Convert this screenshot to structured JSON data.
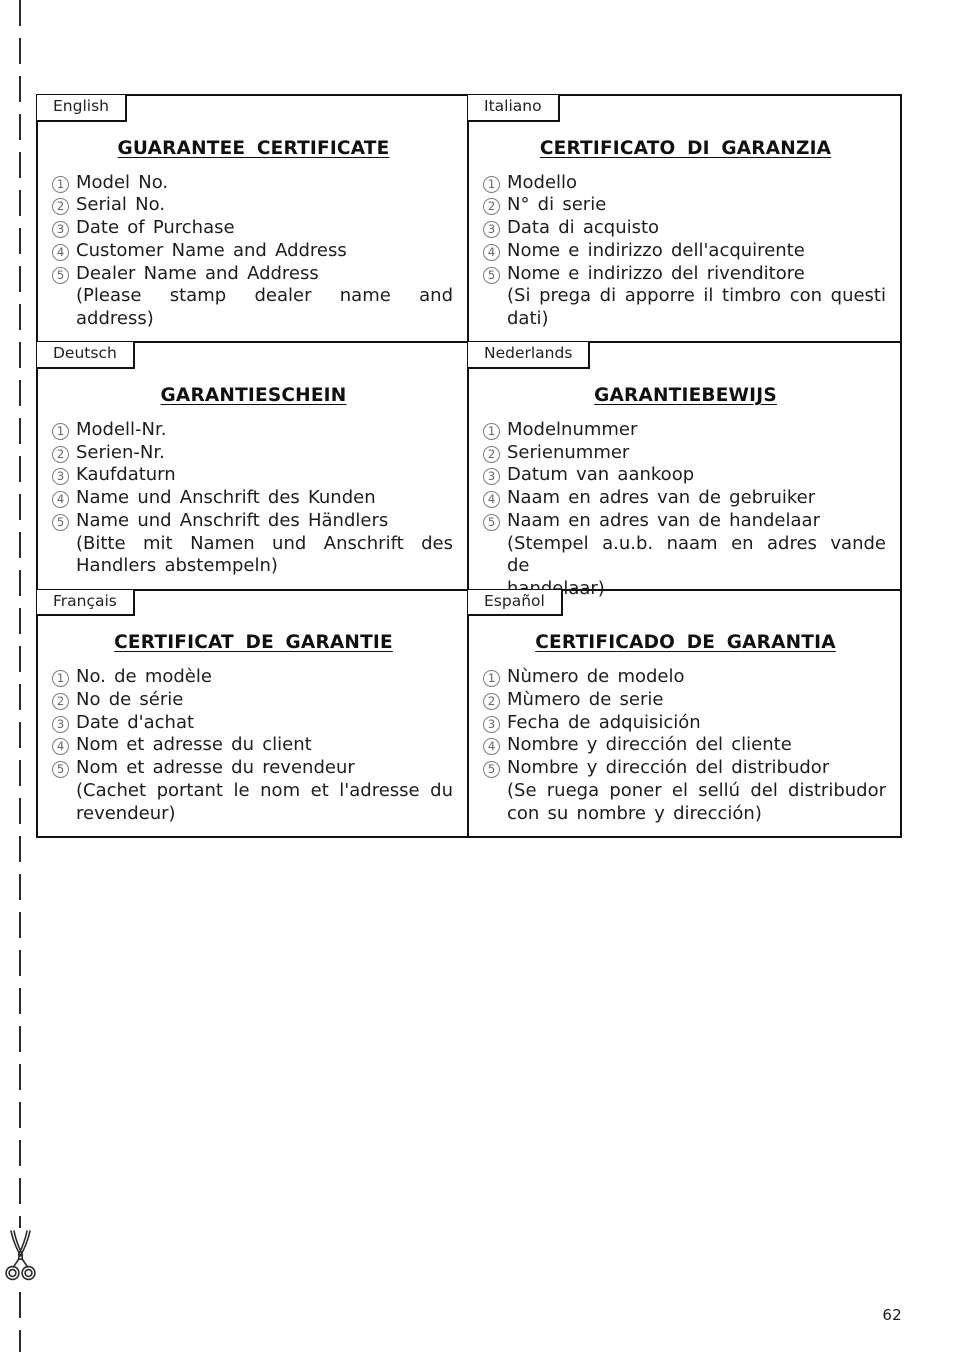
{
  "page": {
    "number": "62",
    "cut_line_icon": "scissors-icon"
  },
  "certificates": [
    {
      "language": "English",
      "title": "GUARANTEE  CERTIFICATE",
      "items": [
        "Model  No.",
        "Serial  No.",
        "Date  of  Purchase",
        "Customer  Name  and  Address",
        "Dealer  Name  and  Address"
      ],
      "note_lines": [
        "(Please  stamp  dealer  name  and  address)"
      ]
    },
    {
      "language": "Italiano",
      "title": "CERTIFICATO  DI  GARANZIA",
      "items": [
        "Modello",
        "N°  di  serie",
        "Data  di  acquisto",
        "Nome  e  indirizzo  dell'acquirente",
        "Nome  e  indirizzo  del  rivenditore"
      ],
      "note_lines": [
        "(Si  prega  di  apporre  il  timbro  con  questi",
        "dati)"
      ]
    },
    {
      "language": "Deutsch",
      "title": "GARANTIESCHEIN",
      "items": [
        "Modell-Nr.",
        "Serien-Nr.",
        "Kaufdaturn",
        "Name  und  Anschrift  des  Kunden",
        "Name  und  Anschrift  des  Händlers"
      ],
      "note_lines": [
        "(Bitte  mit  Namen  und  Anschrift  des",
        "Handlers  abstempeln)"
      ]
    },
    {
      "language": "Nederlands",
      "title": "GARANTIEBEWIJS",
      "items": [
        "Modelnummer",
        "Serienummer",
        "Datum  van  aankoop",
        "Naam  en  adres  van  de  gebruiker",
        "Naam  en  adres  van  de  handelaar"
      ],
      "note_lines": [
        "(Stempel  a.u.b.  naam  en  adres  vande  de",
        "handelaar)"
      ]
    },
    {
      "language": "Français",
      "title": "CERTIFICAT  DE  GARANTIE",
      "items": [
        "No.  de  modèle",
        "No  de  série",
        "Date  d'achat",
        "Nom  et  adresse  du  client",
        "Nom  et  adresse  du  revendeur"
      ],
      "note_lines": [
        "(Cachet  portant  le  nom  et  l'adresse  du",
        "revendeur)"
      ]
    },
    {
      "language": "Español",
      "title": "CERTIFICADO  DE  GARANTIA",
      "items": [
        "Nùmero  de  modelo",
        "Mùmero  de  serie",
        "Fecha  de  adquisición",
        "Nombre  y  dirección  del  cliente",
        "Nombre  y  dirección  del  distribudor"
      ],
      "note_lines": [
        "(Se  ruega  poner  el  sellú  del  distribudor",
        "con  su  nombre  y  dirección)"
      ]
    }
  ],
  "numerals": [
    "1",
    "2",
    "3",
    "4",
    "5"
  ]
}
